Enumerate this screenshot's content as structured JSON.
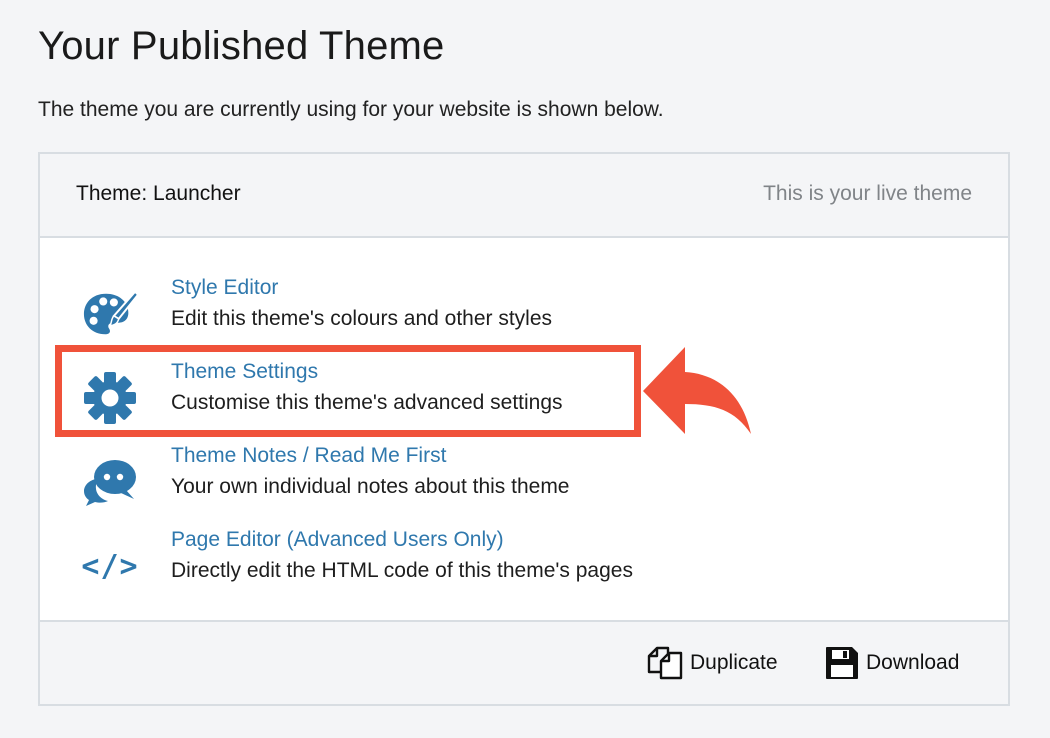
{
  "page": {
    "title": "Your Published Theme",
    "subtitle": "The theme you are currently using for your website is shown below."
  },
  "panel": {
    "theme_name": "Theme: Launcher",
    "live_label": "This is your live theme",
    "options": [
      {
        "title": "Style Editor",
        "description": "Edit this theme's colours and other styles",
        "icon": "palette-icon"
      },
      {
        "title": "Theme Settings",
        "description": "Customise this theme's advanced settings",
        "icon": "gear-icon"
      },
      {
        "title": "Theme Notes / Read Me First",
        "description": "Your own individual notes about this theme",
        "icon": "chat-bubbles-icon"
      },
      {
        "title": "Page Editor (Advanced Users Only)",
        "description": "Directly edit the HTML code of this theme's pages",
        "icon": "code-icon",
        "glyph": "</>"
      }
    ],
    "footer": {
      "duplicate_label": "Duplicate",
      "download_label": "Download"
    }
  },
  "annotation": {
    "highlight_color": "#f0523a",
    "highlighted_option": "Theme Settings"
  },
  "colors": {
    "link": "#2f78ad",
    "background": "#f4f5f7",
    "border": "#d8dde2"
  }
}
